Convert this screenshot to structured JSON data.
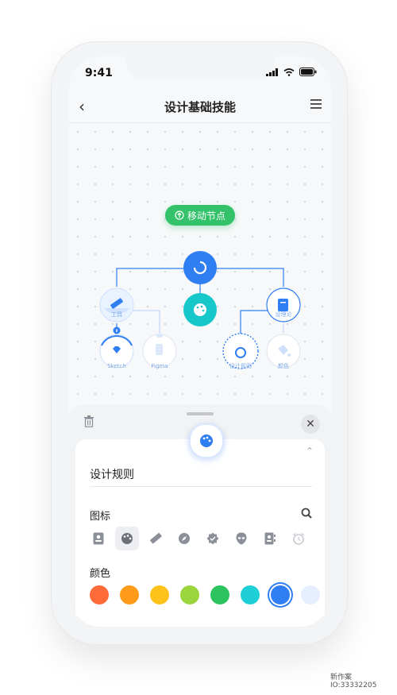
{
  "status": {
    "time": "9:41"
  },
  "nav": {
    "title": "设计基础技能"
  },
  "canvas": {
    "move_button_label": "移动节点",
    "nodes": {
      "tools": "工具",
      "sketch": "Sketch",
      "figma": "Figma",
      "theory": "设理论",
      "design_spec": "设计规则",
      "color": "颜色"
    }
  },
  "sheet": {
    "name_value": "设计规则",
    "icon_section_label": "图标",
    "color_section_label": "颜色"
  },
  "palette": [
    "#ff6a39",
    "#ff9a1a",
    "#ffc21a",
    "#9bd53e",
    "#2dc45f",
    "#1fcfd6",
    "#2f7ef2",
    "#e6efff"
  ],
  "accent": "#2f7ef2",
  "watermark": {
    "line1": "新作案",
    "line2": "IO:33332205"
  }
}
